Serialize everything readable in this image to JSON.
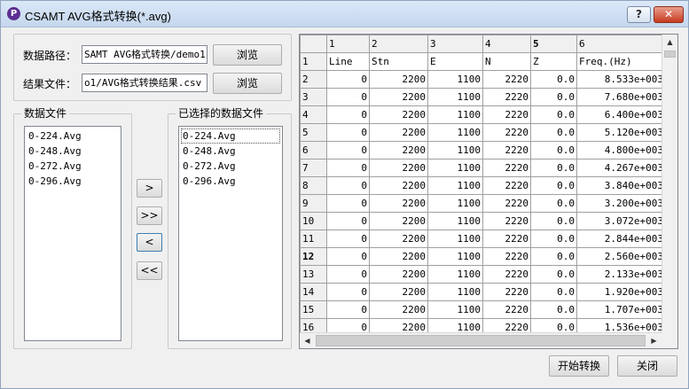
{
  "window": {
    "title": "CSAMT AVG格式转换(*.avg)",
    "app_icon": "P",
    "help_label": "?",
    "close_label": "✕"
  },
  "form": {
    "data_path_label": "数据路径：",
    "data_path_value": "SAMT AVG格式转换/demo1",
    "result_file_label": "结果文件：",
    "result_file_value": "o1/AVG格式转换结果.csv",
    "browse_label": "浏览"
  },
  "data_files": {
    "title": "数据文件",
    "items": [
      "0-224.Avg",
      "0-248.Avg",
      "0-272.Avg",
      "0-296.Avg"
    ]
  },
  "move_buttons": {
    "add": ">",
    "add_all": ">>",
    "remove": "<",
    "remove_all": "<<"
  },
  "selected_files": {
    "title": "已选择的数据文件",
    "items": [
      "0-224.Avg",
      "0-248.Avg",
      "0-272.Avg",
      "0-296.Avg"
    ]
  },
  "grid": {
    "col_numbers": [
      "1",
      "2",
      "3",
      "4",
      "5",
      "6"
    ],
    "header_row_number": "1",
    "headers": [
      "Line",
      "Stn",
      "E",
      "N",
      "Z",
      "Freq.(Hz)"
    ],
    "rows": [
      {
        "n": "2",
        "cells": [
          "0",
          "2200",
          "1100",
          "2220",
          "0.0",
          "8.533e+003"
        ]
      },
      {
        "n": "3",
        "cells": [
          "0",
          "2200",
          "1100",
          "2220",
          "0.0",
          "7.680e+003"
        ]
      },
      {
        "n": "4",
        "cells": [
          "0",
          "2200",
          "1100",
          "2220",
          "0.0",
          "6.400e+003"
        ]
      },
      {
        "n": "5",
        "cells": [
          "0",
          "2200",
          "1100",
          "2220",
          "0.0",
          "5.120e+003"
        ]
      },
      {
        "n": "6",
        "cells": [
          "0",
          "2200",
          "1100",
          "2220",
          "0.0",
          "4.800e+003"
        ]
      },
      {
        "n": "7",
        "cells": [
          "0",
          "2200",
          "1100",
          "2220",
          "0.0",
          "4.267e+003"
        ]
      },
      {
        "n": "8",
        "cells": [
          "0",
          "2200",
          "1100",
          "2220",
          "0.0",
          "3.840e+003"
        ]
      },
      {
        "n": "9",
        "cells": [
          "0",
          "2200",
          "1100",
          "2220",
          "0.0",
          "3.200e+003"
        ]
      },
      {
        "n": "10",
        "cells": [
          "0",
          "2200",
          "1100",
          "2220",
          "0.0",
          "3.072e+003"
        ]
      },
      {
        "n": "11",
        "cells": [
          "0",
          "2200",
          "1100",
          "2220",
          "0.0",
          "2.844e+003"
        ]
      },
      {
        "n": "12",
        "cells": [
          "0",
          "2200",
          "1100",
          "2220",
          "0.0",
          "2.560e+003"
        ]
      },
      {
        "n": "13",
        "cells": [
          "0",
          "2200",
          "1100",
          "2220",
          "0.0",
          "2.133e+003"
        ]
      },
      {
        "n": "14",
        "cells": [
          "0",
          "2200",
          "1100",
          "2220",
          "0.0",
          "1.920e+003"
        ]
      },
      {
        "n": "15",
        "cells": [
          "0",
          "2200",
          "1100",
          "2220",
          "0.0",
          "1.707e+003"
        ]
      },
      {
        "n": "16",
        "cells": [
          "0",
          "2200",
          "1100",
          "2220",
          "0.0",
          "1.536e+003"
        ]
      }
    ]
  },
  "footer": {
    "start_label": "开始转换",
    "close_label": "关闭"
  }
}
